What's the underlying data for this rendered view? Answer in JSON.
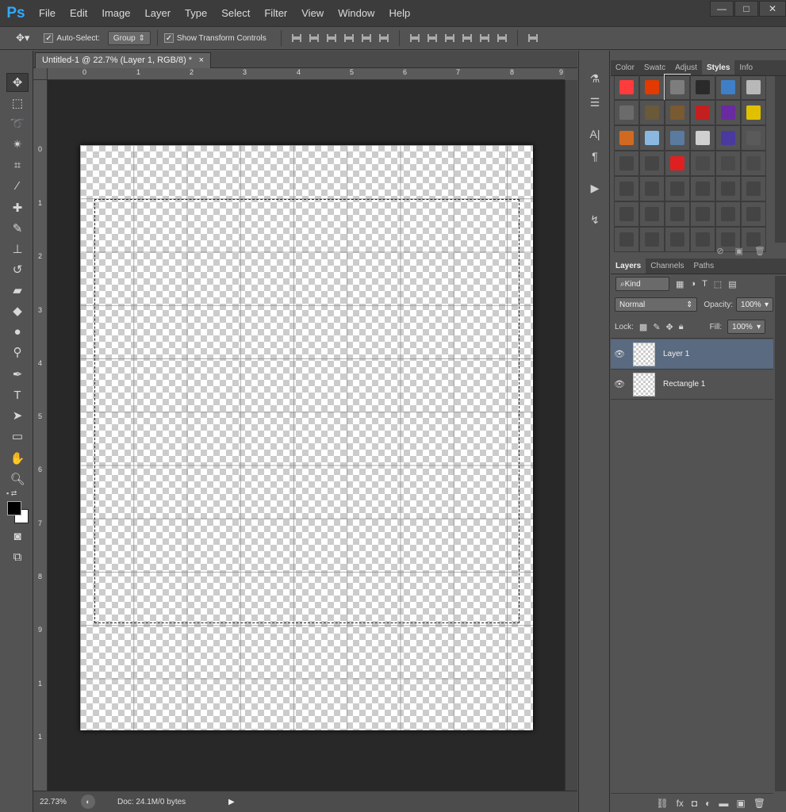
{
  "app": {
    "logo": "Ps"
  },
  "menu": [
    "File",
    "Edit",
    "Image",
    "Layer",
    "Type",
    "Select",
    "Filter",
    "View",
    "Window",
    "Help"
  ],
  "window_controls": {
    "minimize": "—",
    "maximize": "□",
    "close": "✕"
  },
  "options": {
    "auto_select_label": "Auto-Select:",
    "auto_select_checked": "✓",
    "auto_select_target": "Group",
    "transform_label": "Show Transform Controls",
    "transform_checked": "✓"
  },
  "document": {
    "tab_title": "Untitled-1 @ 22.7% (Layer 1, RGB/8) *",
    "close": "×"
  },
  "rulers": {
    "h": [
      "0",
      "1",
      "2",
      "3",
      "4",
      "5",
      "6",
      "7",
      "8",
      "9"
    ],
    "v": [
      "0",
      "1",
      "2",
      "3",
      "4",
      "5",
      "6",
      "7",
      "8",
      "9",
      "1",
      "1"
    ]
  },
  "status": {
    "zoom": "22.73%",
    "doc": "Doc: 24.1M/0 bytes"
  },
  "top_panel": {
    "tabs": [
      "Color",
      "Swatc",
      "Adjust",
      "Styles",
      "Info"
    ],
    "active": "Styles",
    "style_colors": [
      "#ff3b3b",
      "#e23a00",
      "#7d7d7d",
      "#2a2a2a",
      "#3e7fc7",
      "#b8b8b8",
      "#6b6b6b",
      "#6a5a3a",
      "#7a5a30",
      "#c41f1f",
      "#6a2aa0",
      "#e0c000",
      "#d06a20",
      "#8ab8e0",
      "#5a7aa0",
      "#d0d0d0",
      "#4a3aa0",
      "#5a5a5a",
      "#454545",
      "#454545",
      "#e02020",
      "#4a4a4a",
      "#4a4a4a",
      "#4a4a4a",
      "#444",
      "#444",
      "#444",
      "#444",
      "#444",
      "#444",
      "#444",
      "#444",
      "#444",
      "#444",
      "#444",
      "#444",
      "#444",
      "#444",
      "#444",
      "#444",
      "#444",
      "#444"
    ]
  },
  "layers_panel": {
    "tabs": [
      "Layers",
      "Channels",
      "Paths"
    ],
    "active": "Layers",
    "filter": "Kind",
    "blend_mode": "Normal",
    "opacity_label": "Opacity:",
    "opacity": "100%",
    "lock_label": "Lock:",
    "fill_label": "Fill:",
    "fill": "100%",
    "layers": [
      {
        "name": "Layer 1",
        "selected": true
      },
      {
        "name": "Rectangle 1",
        "selected": false
      }
    ]
  },
  "colors": {
    "selected_layer": "#5a6a80",
    "accent": "#31a8ff"
  }
}
